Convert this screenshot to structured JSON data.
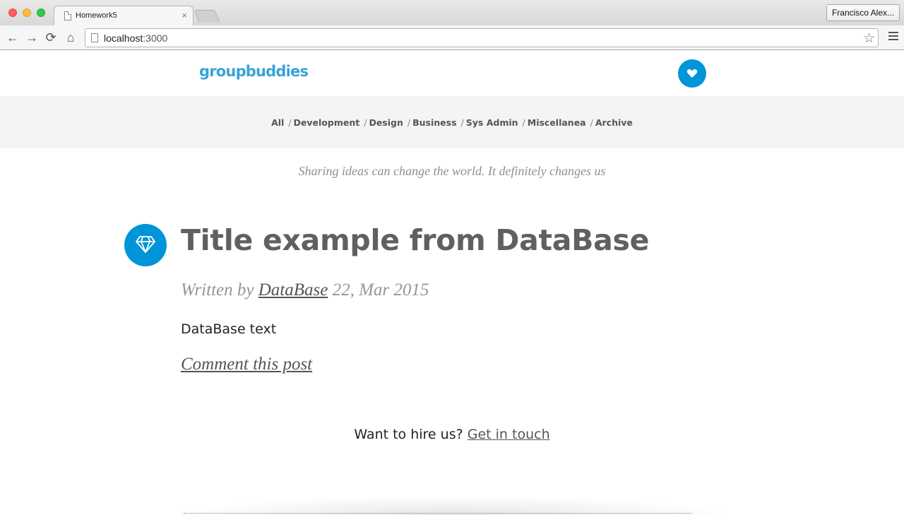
{
  "browser": {
    "tab_title": "Homework5",
    "tab_close": "×",
    "profile_name": "Francisco Alex...",
    "url_host": "localhost",
    "url_port": ":3000",
    "nav_back": "←",
    "nav_forward": "→",
    "nav_reload": "⟳",
    "nav_home": "⌂",
    "star": "☆"
  },
  "site": {
    "logo": "groupbuddies",
    "accent_color": "#0094d8"
  },
  "nav": {
    "items": [
      "All",
      "Development",
      "Design",
      "Business",
      "Sys Admin",
      "Miscellanea",
      "Archive"
    ],
    "separator": "/"
  },
  "tagline": "Sharing ideas can change the world. It definitely changes us",
  "post": {
    "title": "Title example from DataBase",
    "written_by": "Written by",
    "author": "DataBase",
    "date": "22, Mar 2015",
    "body": "DataBase text",
    "comment_link": "Comment this post"
  },
  "footer": {
    "hire_text": "Want to hire us?",
    "contact_link": "Get in touch"
  }
}
